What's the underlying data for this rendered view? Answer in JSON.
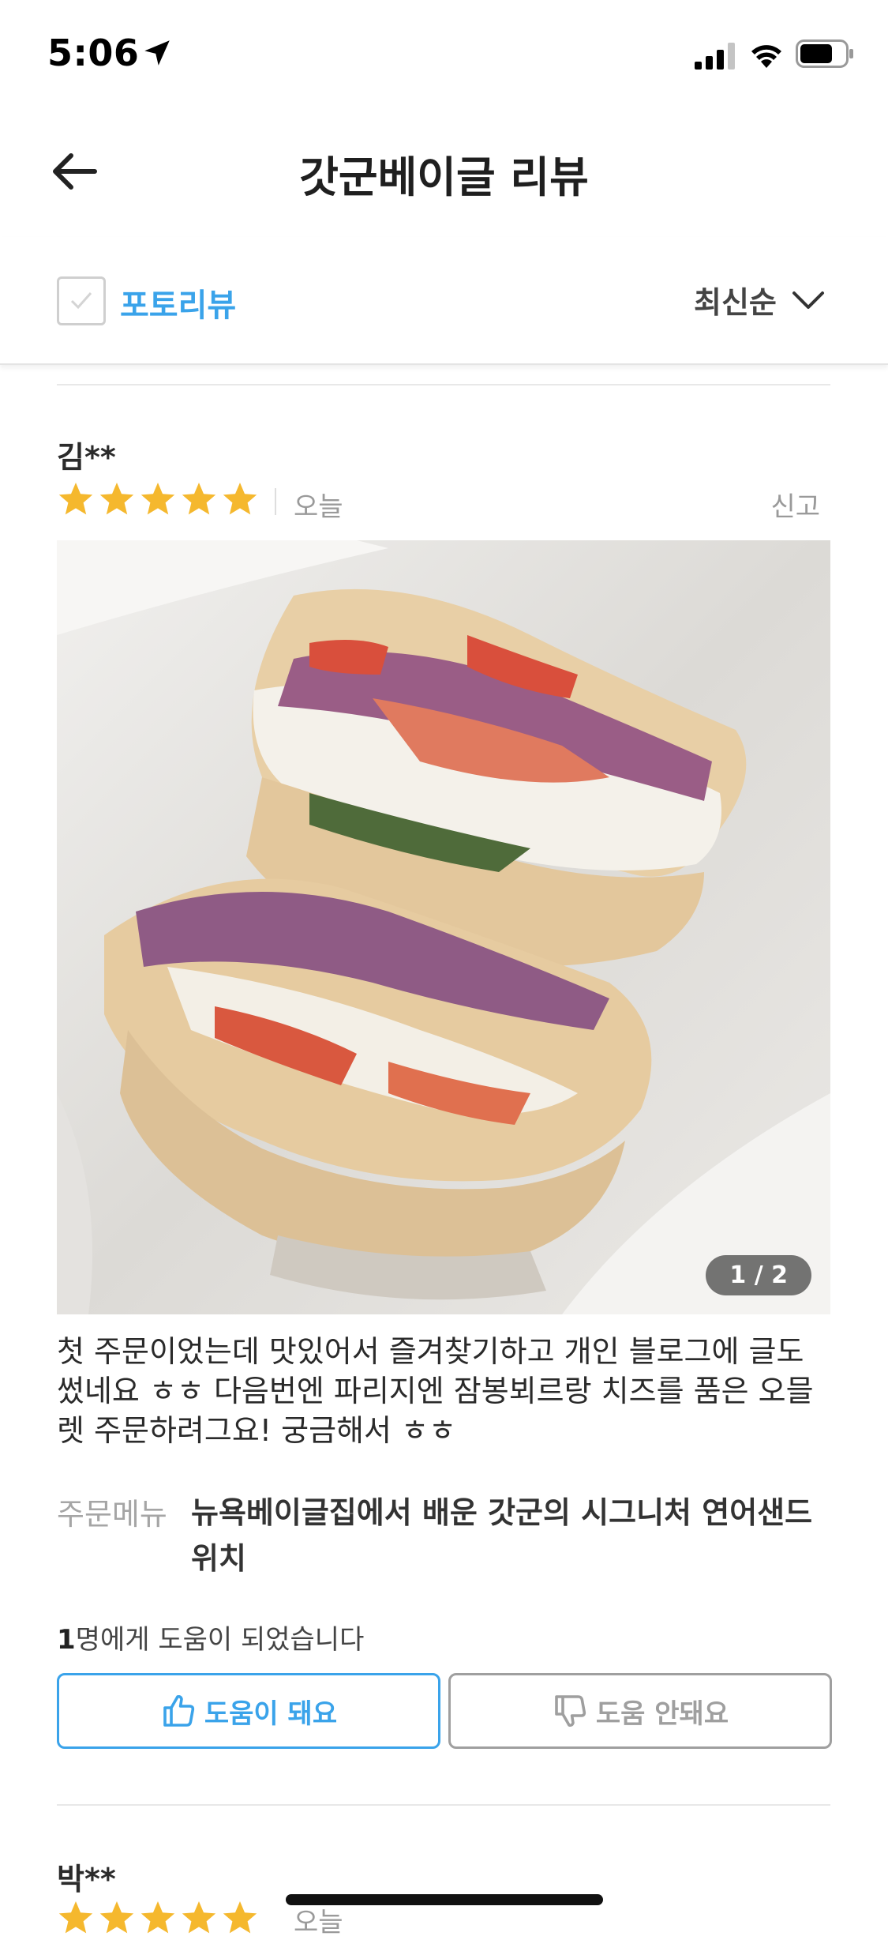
{
  "status_bar": {
    "time": "5:06"
  },
  "header": {
    "title": "갓군베이글 리뷰",
    "back_icon": "arrow-left-icon"
  },
  "filter": {
    "photo_review_label": "포토리뷰",
    "photo_review_checked": false,
    "sort_label": "최신순"
  },
  "reviews": [
    {
      "name": "김**",
      "rating": 5,
      "date": "오늘",
      "report_label": "신고",
      "photo_counter": "1 / 2",
      "text": "첫 주문이었는데 맛있어서 즐겨찾기하고 개인 블로그에 글도 썼네요 ㅎㅎ 다음번엔 파리지엔 잠봉뵈르랑 치즈를 품은 오믈렛 주문하려그요! 궁금해서 ㅎㅎ",
      "menu_label": "주문메뉴",
      "menu_value": "뉴욕베이글집에서 배운 갓군의 시그니처 연어샌드위치",
      "helpful_count": "1",
      "helpful_suffix": "명에게 도움이 되었습니다",
      "helpful_button": "도움이 돼요",
      "unhelpful_button": "도움 안돼요"
    },
    {
      "name": "박**",
      "rating": 5,
      "date": "오늘"
    }
  ],
  "colors": {
    "accent": "#3aa3ea",
    "star": "#f5b82e",
    "muted": "#9a9a9a"
  }
}
